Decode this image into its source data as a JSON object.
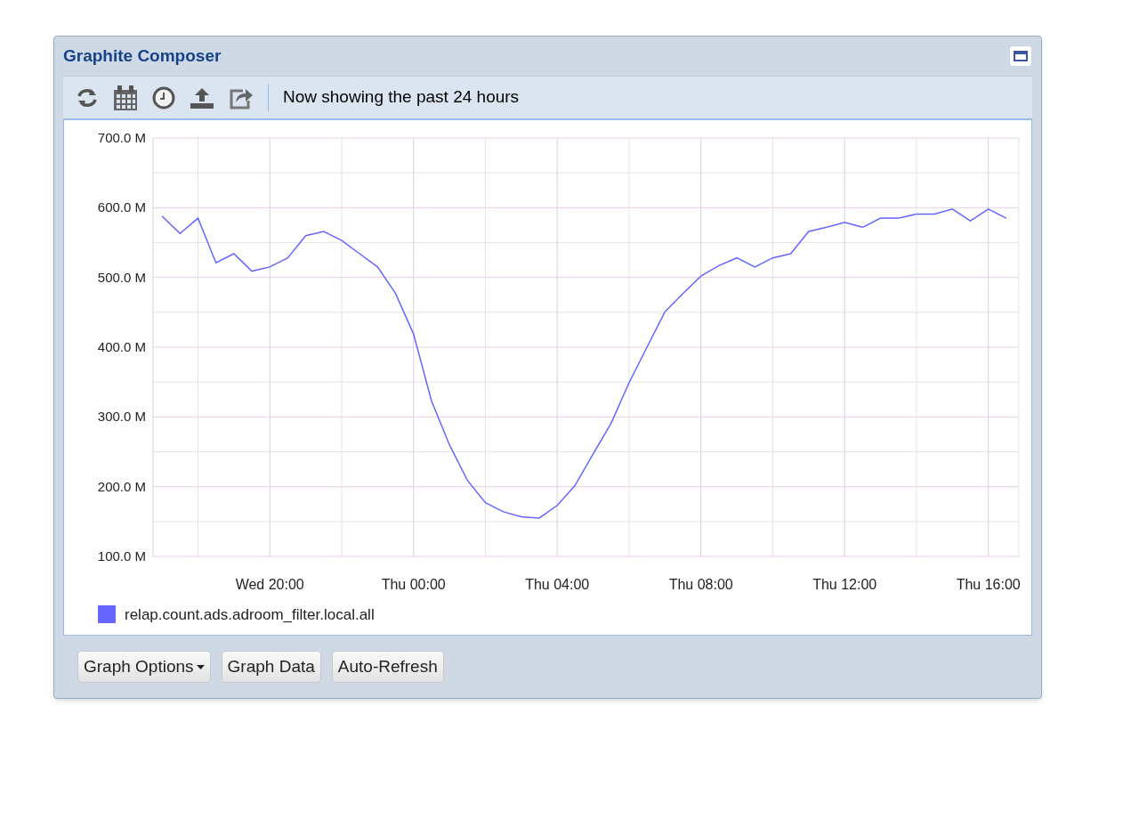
{
  "window": {
    "title": "Graphite Composer"
  },
  "toolbar": {
    "status": "Now showing the past 24 hours"
  },
  "graph": {
    "chart_data": {
      "type": "line",
      "categories": [
        null,
        null,
        null,
        null,
        null,
        null,
        "Wed 20:00",
        null,
        null,
        null,
        null,
        null,
        null,
        null,
        "Thu 00:00",
        null,
        null,
        null,
        null,
        null,
        null,
        null,
        "Thu 04:00",
        null,
        null,
        null,
        null,
        null,
        null,
        null,
        "Thu 08:00",
        null,
        null,
        null,
        null,
        null,
        null,
        null,
        "Thu 12:00",
        null,
        null,
        null,
        null,
        null,
        null,
        null,
        "Thu 16:00",
        null
      ],
      "series": [
        {
          "name": "relap.count.ads.adroom_filter.local.all",
          "color": "#6666ff",
          "values": [
            588,
            563,
            585,
            521,
            534,
            509,
            515,
            528,
            560,
            566,
            553,
            534,
            515,
            477,
            419,
            323,
            260,
            209,
            177,
            164,
            157,
            155,
            173,
            202,
            247,
            291,
            349,
            400,
            451,
            477,
            502,
            517,
            528,
            515,
            528,
            534,
            566,
            572,
            579,
            572,
            585,
            585,
            591,
            591,
            598,
            581,
            598,
            585
          ]
        }
      ],
      "grid": true,
      "ylim": [
        100,
        700
      ],
      "yticks": [
        {
          "value": 700,
          "label": "700.0 M"
        },
        {
          "value": 600,
          "label": "600.0 M"
        },
        {
          "value": 500,
          "label": "500.0 M"
        },
        {
          "value": 400,
          "label": "400.0 M"
        },
        {
          "value": 300,
          "label": "300.0 M"
        },
        {
          "value": 200,
          "label": "200.0 M"
        },
        {
          "value": 100,
          "label": "100.0 M"
        }
      ]
    }
  },
  "buttons": [
    {
      "label": "Graph Options",
      "dropdown": true
    },
    {
      "label": "Graph Data",
      "dropdown": false
    },
    {
      "label": "Auto-Refresh",
      "dropdown": false
    }
  ]
}
